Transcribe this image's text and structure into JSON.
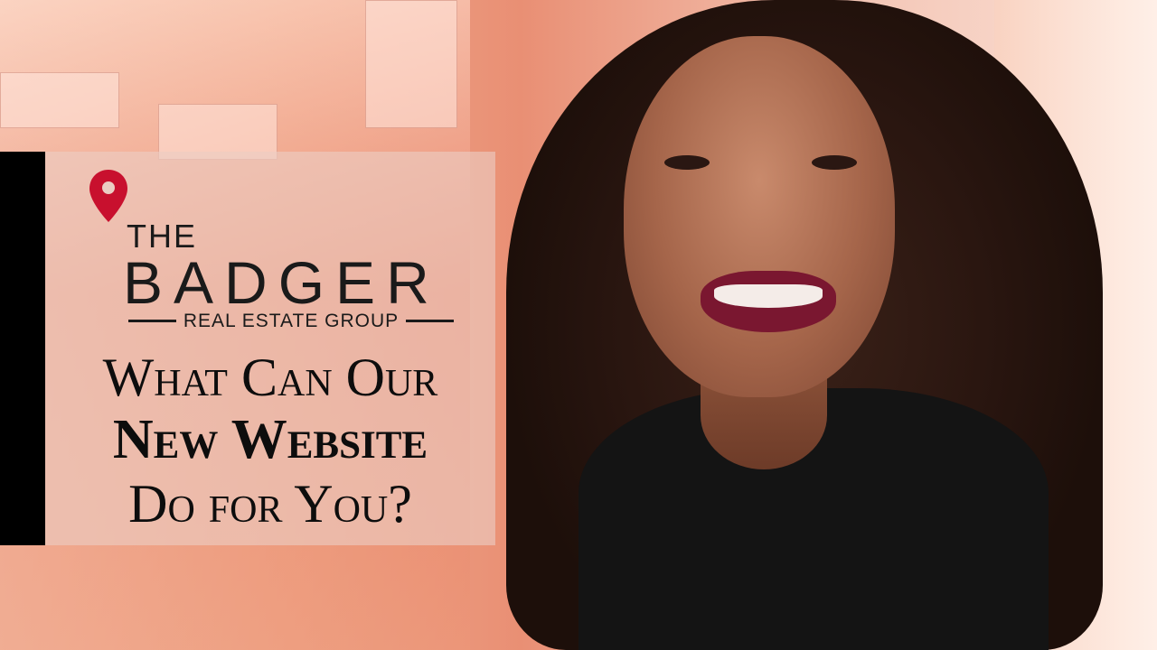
{
  "logo": {
    "line1": "THE",
    "line2": "BADGER",
    "line3": "REAL ESTATE GROUP",
    "pin_icon": "map-pin-icon",
    "pin_color": "#c8102e"
  },
  "title": {
    "line1": "What Can Our",
    "line2": "New Website",
    "line3": "Do for You?"
  },
  "colors": {
    "panel": "#ebcdc3",
    "bar": "#000000",
    "text": "#0d0d0d"
  }
}
